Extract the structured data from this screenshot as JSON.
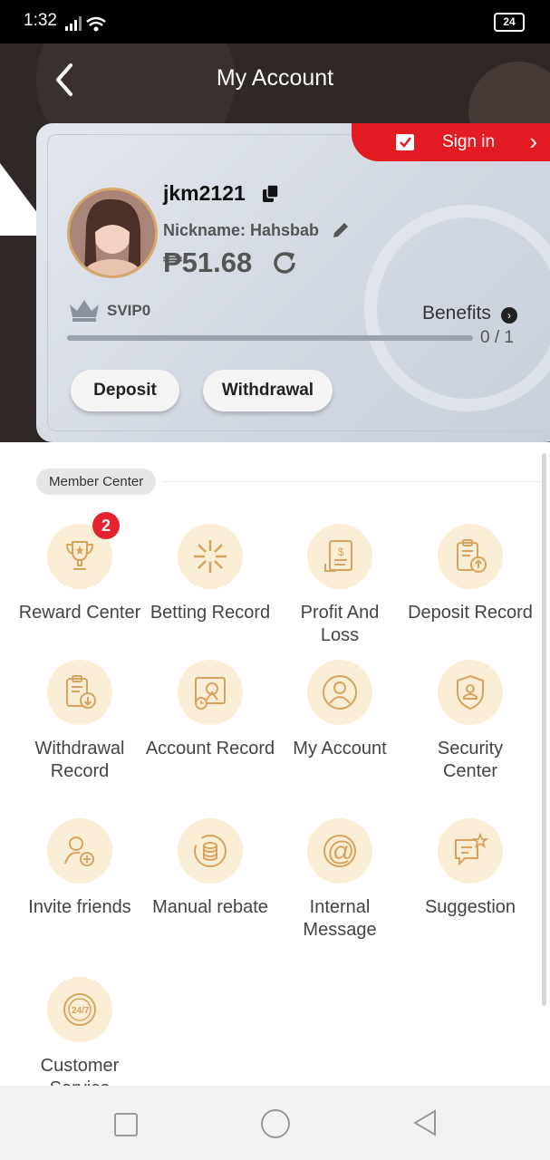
{
  "status_bar": {
    "time": "1:32",
    "battery": "24"
  },
  "header": {
    "title": "My Account"
  },
  "signin": {
    "label": "Sign in"
  },
  "profile": {
    "username": "jkm2121",
    "nickname": "Nickname: Hahsbab",
    "balance": "₱51.68",
    "vip_level": "SVIP0",
    "benefits_label": "Benefits",
    "progress_text": "0 / 1",
    "progress_fraction": 0
  },
  "actions": {
    "deposit": "Deposit",
    "withdrawal": "Withdrawal"
  },
  "member_center": {
    "label": "Member Center",
    "items": [
      {
        "label": "Reward Center",
        "icon": "trophy-icon",
        "badge": "2"
      },
      {
        "label": "Betting Record",
        "icon": "betting-icon"
      },
      {
        "label": "Profit And Loss",
        "icon": "receipt-icon"
      },
      {
        "label": "Deposit Record",
        "icon": "clipboard-upload-icon"
      },
      {
        "label": "Withdrawal Record",
        "icon": "clipboard-download-icon"
      },
      {
        "label": "Account Record",
        "icon": "account-record-icon"
      },
      {
        "label": "My Account",
        "icon": "user-icon"
      },
      {
        "label": "Security Center",
        "icon": "shield-user-icon"
      },
      {
        "label": "Invite friends",
        "icon": "add-user-icon"
      },
      {
        "label": "Manual rebate",
        "icon": "coins-icon"
      },
      {
        "label": "Internal Message",
        "icon": "at-icon"
      },
      {
        "label": "Suggestion",
        "icon": "chat-star-icon"
      },
      {
        "label": "Customer Service",
        "icon": "support-247-icon"
      }
    ]
  },
  "colors": {
    "accent_red": "#e31b23",
    "gold": "#d8a86b",
    "icon_bg": "#fbeed6",
    "header_bg": "#2f2826"
  }
}
